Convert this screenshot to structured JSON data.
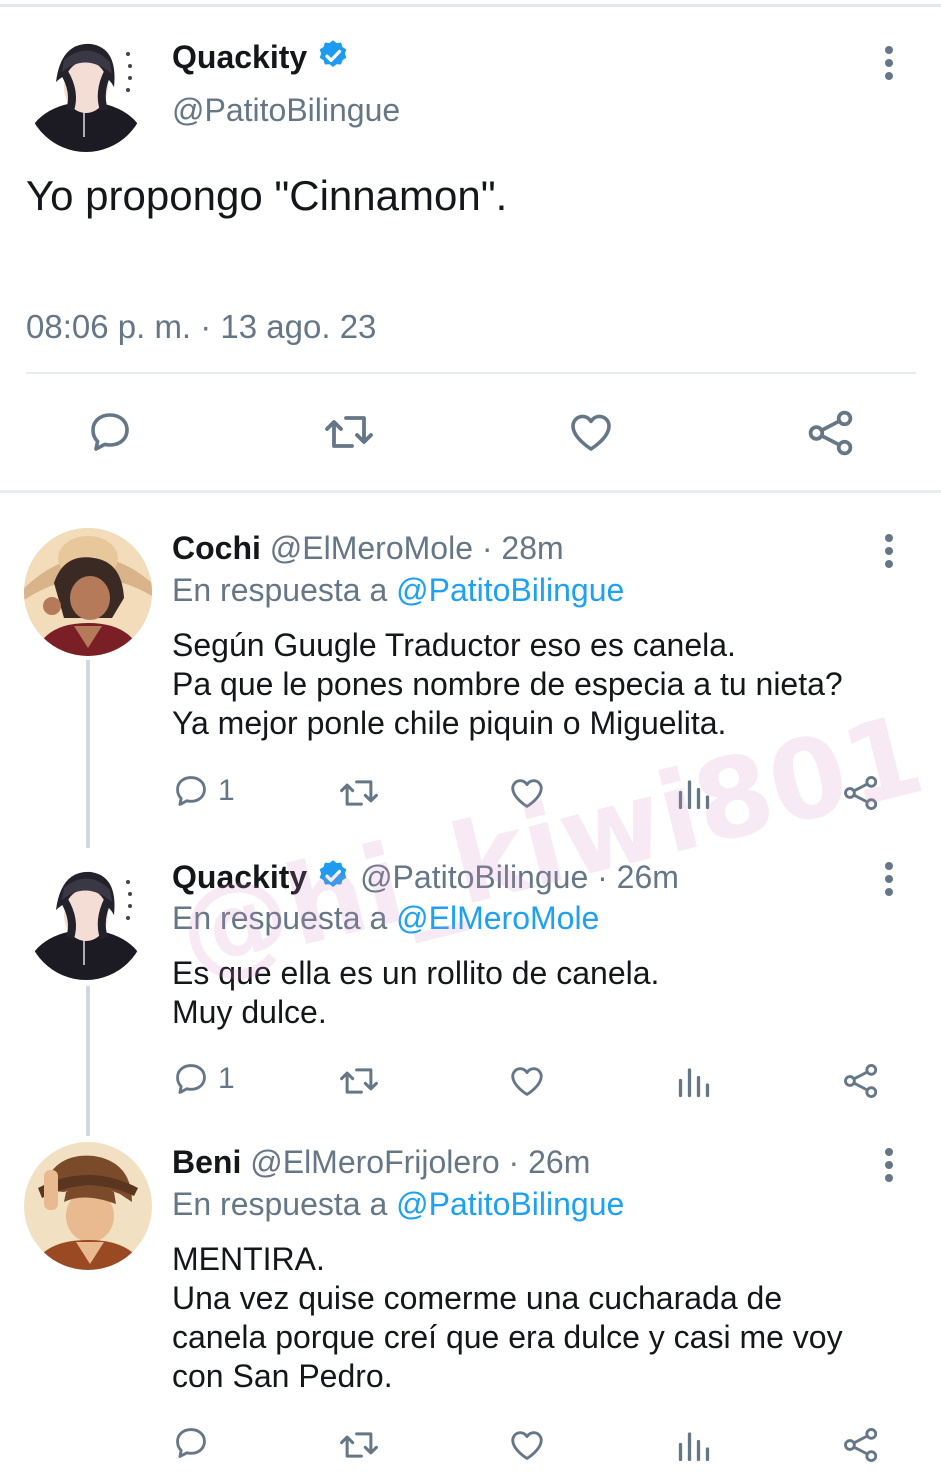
{
  "main_tweet": {
    "author_name": "Quackity",
    "author_handle": "@PatitoBilingue",
    "text": "Yo propongo \"Cinnamon\".",
    "timestamp": "08:06 p. m. · 13 ago. 23",
    "verified": true
  },
  "replies": [
    {
      "author_name": "Cochi",
      "author_handle": "@ElMeroMole",
      "time": "· 28m",
      "reply_to_label": "En respuesta a",
      "reply_to_handle": "@PatitoBilingue",
      "text_lines": [
        "Según Guugle Traductor eso es canela.",
        "Pa que le pones nombre de especia a tu nieta?",
        "Ya mejor ponle chile piquin o Miguelita."
      ],
      "reply_count": "1",
      "verified": false
    },
    {
      "author_name": "Quackity",
      "author_handle": "@PatitoBilingue",
      "time": "· 26m",
      "reply_to_label": "En respuesta a",
      "reply_to_handle": "@ElMeroMole",
      "text_lines": [
        "Es que ella es un rollito de canela.",
        "Muy dulce."
      ],
      "reply_count": "1",
      "verified": true
    },
    {
      "author_name": "Beni",
      "author_handle": "@ElMeroFrijolero",
      "time": "· 26m",
      "reply_to_label": "En respuesta a",
      "reply_to_handle": "@PatitoBilingue",
      "text_lines": [
        "MENTIRA.",
        "Una vez quise comerme una cucharada de",
        "canela porque creí que era dulce y casi me voy",
        "con San Pedro."
      ],
      "reply_count": "",
      "verified": false
    }
  ],
  "watermark": "@hi_kiwi801",
  "colors": {
    "accent": "#1da1f2",
    "secondary_text": "#657786",
    "verified": "#1d9bf0"
  }
}
